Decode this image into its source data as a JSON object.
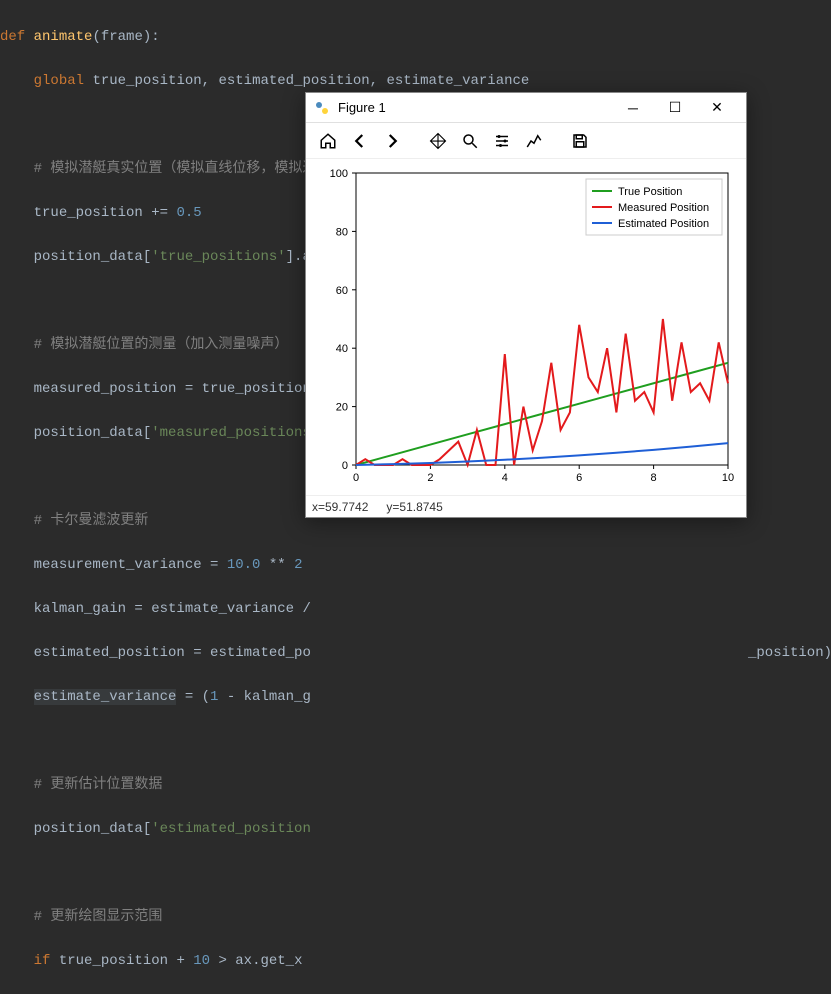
{
  "code": {
    "l1_def": "def",
    "l1_fn": "animate",
    "l1_param": "frame",
    "l2_global": "global",
    "l2_vars": "true_position, estimated_position, estimate_variance",
    "c1": "# 模拟潜艇真实位置（模拟直线位移，模拟过程噪声）",
    "l3a": "true_position += ",
    "l3b": "0.5",
    "l4a": "position_data[",
    "l4b": "'true_positions'",
    "l4c": "].a",
    "c2": "# 模拟潜艇位置的测量（加入测量噪声）",
    "l5": "measured_position = true_position",
    "l6a": "position_data[",
    "l6b": "'measured_positions",
    "c3": "# 卡尔曼滤波更新",
    "l7a": "measurement_variance = ",
    "l7b": "10.0",
    "l7c": " ** ",
    "l7d": "2",
    "l8": "kalman_gain = estimate_variance /",
    "l9a": "estimated_position = estimated_po",
    "l9b": "_position)",
    "l10a": "estimate_variance",
    "l10b": " = (",
    "l10c": "1",
    "l10d": " - kalman_g",
    "c4": "# 更新估计位置数据",
    "l11a": "position_data[",
    "l11b": "'estimated_position",
    "c5": "# 更新绘图显示范围",
    "l12a": "if",
    "l12b": " true_position + ",
    "l12c": "10",
    "l12d": " > ax.get_x"
  },
  "figure": {
    "title": "Figure 1",
    "status_x": "x=59.7742",
    "status_y": "y=51.8745",
    "toolbar": {
      "home": "home-icon",
      "back": "back-icon",
      "forward": "forward-icon",
      "pan": "pan-icon",
      "zoom": "zoom-icon",
      "config": "config-icon",
      "subplots": "subplots-icon",
      "save": "save-icon"
    }
  },
  "chart_data": {
    "type": "line",
    "title": "",
    "xlabel": "",
    "ylabel": "",
    "xlim": [
      0,
      10
    ],
    "ylim": [
      0,
      100
    ],
    "xticks": [
      0,
      2,
      4,
      6,
      8,
      10
    ],
    "yticks": [
      0,
      20,
      40,
      60,
      80,
      100
    ],
    "legend": {
      "position": "upper-right",
      "entries": [
        "True Position",
        "Measured Position",
        "Estimated Position"
      ]
    },
    "series": [
      {
        "name": "True Position",
        "color": "#1f9e1f",
        "x": [
          0,
          1,
          2,
          3,
          4,
          5,
          6,
          7,
          8,
          9,
          10
        ],
        "values": [
          0,
          3.5,
          7,
          10.5,
          14,
          17.5,
          21,
          24.5,
          28,
          31.5,
          35
        ]
      },
      {
        "name": "Measured Position",
        "color": "#e31a1c",
        "x": [
          0,
          0.25,
          0.5,
          0.75,
          1,
          1.25,
          1.5,
          1.75,
          2,
          2.25,
          2.5,
          2.75,
          3,
          3.25,
          3.5,
          3.75,
          4,
          4.25,
          4.5,
          4.75,
          5,
          5.25,
          5.5,
          5.75,
          6,
          6.25,
          6.5,
          6.75,
          7,
          7.25,
          7.5,
          7.75,
          8,
          8.25,
          8.5,
          8.75,
          9,
          9.25,
          9.5,
          9.75,
          10
        ],
        "values": [
          0,
          2,
          -3,
          0,
          -5,
          2,
          -3,
          0,
          -5,
          2,
          5,
          8,
          -2,
          12,
          -3,
          0,
          38,
          -2,
          20,
          5,
          15,
          35,
          12,
          18,
          48,
          30,
          25,
          40,
          18,
          45,
          22,
          25,
          18,
          50,
          22,
          42,
          25,
          28,
          22,
          42,
          28
        ]
      },
      {
        "name": "Estimated Position",
        "color": "#1f5fd6",
        "x": [
          0,
          1,
          2,
          3,
          4,
          5,
          6,
          7,
          8,
          9,
          10
        ],
        "values": [
          0,
          0.3,
          0.7,
          1.2,
          1.8,
          2.5,
          3.3,
          4.2,
          5.2,
          6.3,
          7.5
        ]
      }
    ]
  }
}
